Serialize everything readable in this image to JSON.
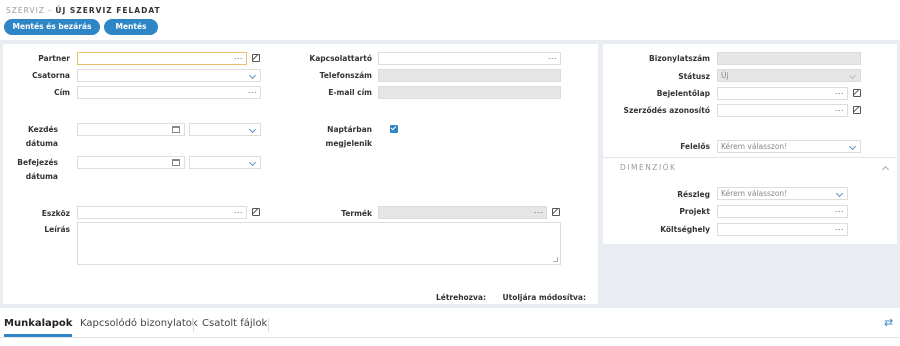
{
  "breadcrumb": {
    "parent": "SZERVIZ",
    "sep": " - ",
    "current": "ÚJ SZERVIZ FELADAT"
  },
  "toolbar": {
    "save_close_label": "Mentés és bezárás",
    "save_label": "Mentés"
  },
  "form": {
    "partner_label": "Partner",
    "channel_label": "Csatorna",
    "address_label": "Cím",
    "start_label_1": "Kezdés",
    "start_label_2": "dátuma",
    "end_label_1": "Befejezés",
    "end_label_2": "dátuma",
    "contact_label": "Kapcsolattartó",
    "phone_label": "Telefonszám",
    "email_label": "E-mail cím",
    "calendar_label_1": "Naptárban",
    "calendar_label_2": "megjelenik",
    "calendar_checked": true,
    "device_label": "Eszköz",
    "product_label": "Termék",
    "description_label": "Leírás",
    "dots": "...",
    "created_label": "Létrehozva:",
    "modified_label": "Utoljára módosítva:"
  },
  "side": {
    "doc_number_label": "Bizonylatszám",
    "status_label": "Státusz",
    "status_value": "Új",
    "report_label": "Bejelentőlap",
    "contract_label": "Szerződés azonosító",
    "owner_label": "Felelős",
    "owner_placeholder": "Kérem válasszon!",
    "dimensions_title": "DIMENZIÓK",
    "department_label": "Részleg",
    "department_placeholder": "Kérem válasszon!",
    "project_label": "Projekt",
    "cost_center_label": "Költséghely"
  },
  "tabs": [
    "Munkalapok",
    "Kapcsolódó bizonylatok",
    "Csatolt fájlok"
  ],
  "colors": {
    "accent": "#2f86c6",
    "highlight_border": "#e8c36a"
  },
  "icons": {
    "external": "external-link-icon",
    "calendar": "calendar-icon",
    "swap": "swap-arrows-icon"
  }
}
